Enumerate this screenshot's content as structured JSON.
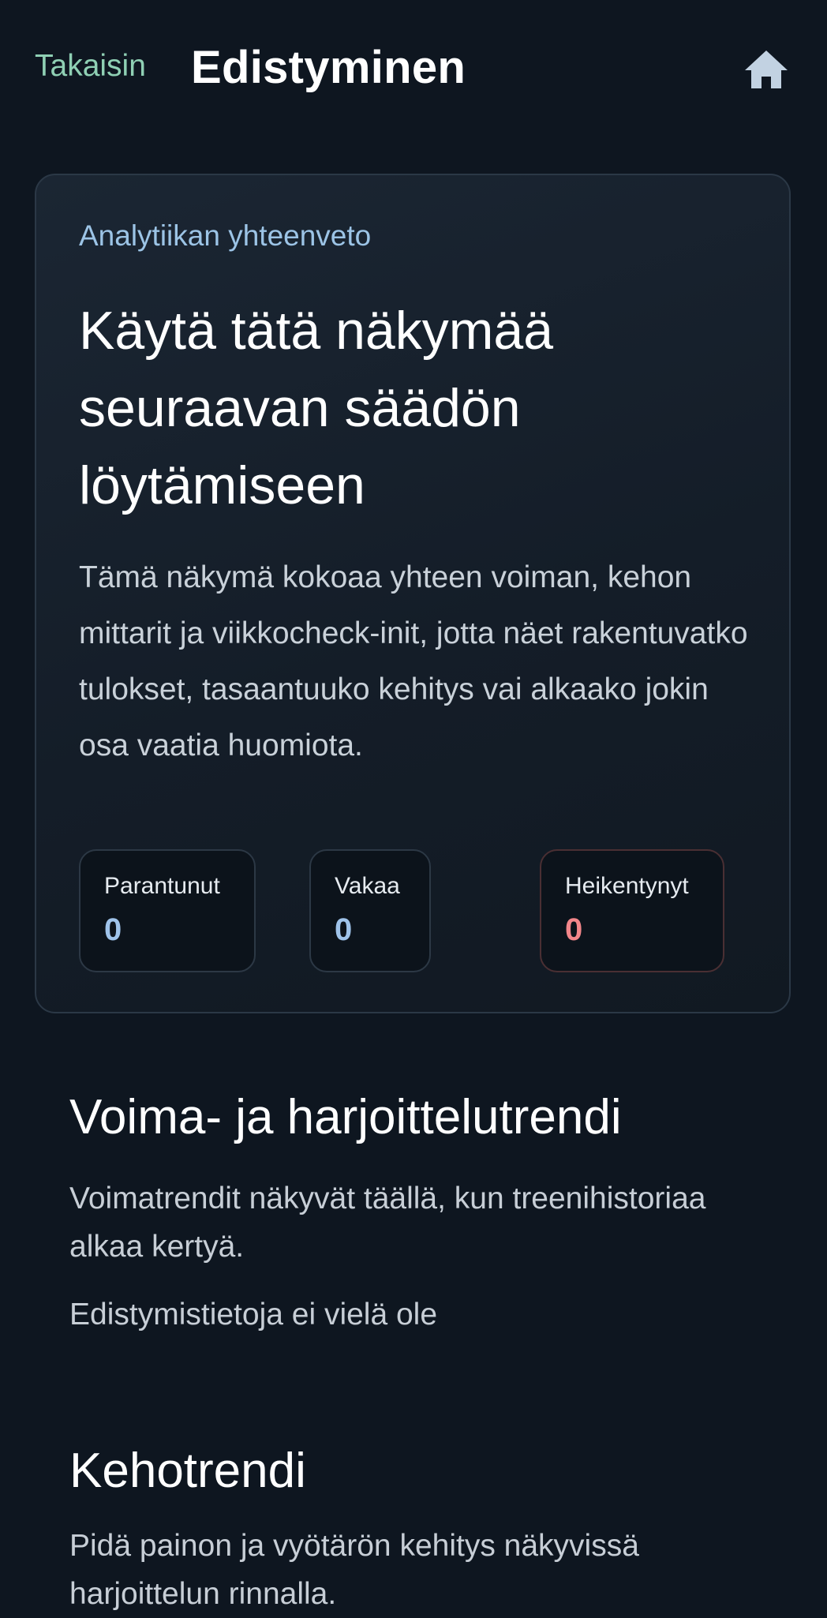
{
  "header": {
    "back_label": "Takaisin",
    "title": "Edistyminen",
    "home_icon": "home-icon"
  },
  "summary": {
    "eyebrow": "Analytiikan yhteenveto",
    "title": "Käytä tätä näkymää seuraavan säädön löytämiseen",
    "description": "Tämä näkymä kokoaa yhteen voiman, kehon mittarit ja viikkocheck-init, jotta näet rakentuvatko tulokset, tasaantuuko kehitys vai alkaako jokin osa vaatia huomiota.",
    "stats": [
      {
        "label": "Parantunut",
        "value": "0",
        "color": "#9fc3ea"
      },
      {
        "label": "Vakaa",
        "value": "0",
        "color": "#9fc3ea"
      },
      {
        "label": "Heikentynyt",
        "value": "0",
        "color": "#f2868a"
      }
    ]
  },
  "strength_trend": {
    "title": "Voima- ja harjoittelutrendi",
    "description": "Voimatrendit näkyvät täällä, kun treenihistoriaa alkaa kertyä.",
    "empty_state": "Edistymistietoja ei vielä ole"
  },
  "body_trend": {
    "title": "Kehotrendi",
    "description": "Pidä painon ja vyötärön kehitys näkyvissä harjoittelun rinnalla."
  },
  "colors": {
    "background": "#0e1620",
    "accent_back": "#8fd0b4",
    "eyebrow": "#9cc4e6",
    "declined": "#f2868a"
  }
}
